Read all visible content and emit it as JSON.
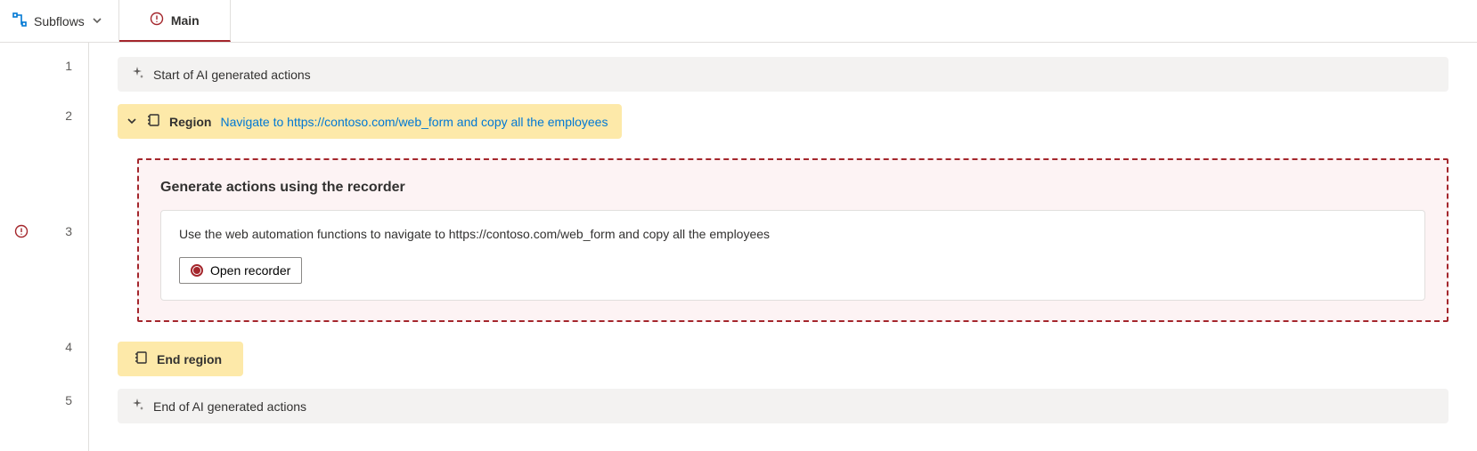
{
  "tabbar": {
    "subflows_label": "Subflows",
    "main_tab_label": "Main"
  },
  "gutter": {
    "line_numbers": [
      "1",
      "2",
      "3",
      "4",
      "5"
    ]
  },
  "rows": {
    "start_comment": "Start of AI generated actions",
    "region": {
      "label": "Region",
      "link_text": "Navigate to https://contoso.com/web_form and copy all the employees"
    },
    "recorder": {
      "title": "Generate actions using the recorder",
      "description": "Use the web automation functions to navigate to https://contoso.com/web_form and copy all the employees",
      "button_label": "Open recorder"
    },
    "end_region_label": "End region",
    "end_comment": "End of AI generated actions"
  }
}
